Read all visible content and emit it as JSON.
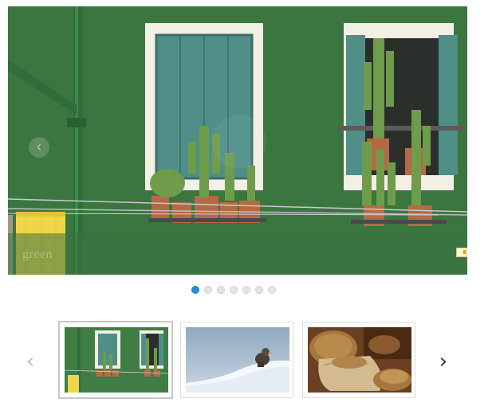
{
  "slider": {
    "caption": "green",
    "prev_glyph": "‹",
    "next_glyph": "›",
    "active_index": 0,
    "slide_count": 7
  },
  "thumbnails": {
    "prev_glyph": "‹",
    "next_glyph": "›",
    "items": [
      {
        "name": "green-wall-windows",
        "active": true
      },
      {
        "name": "bird-on-snow",
        "active": false
      },
      {
        "name": "grain-sacks",
        "active": false
      }
    ]
  },
  "colors": {
    "wall": "#3f7d45",
    "shutter": "#4f8f88",
    "dot_active": "#1e8ed8",
    "dot_inactive": "#e4e4e4"
  }
}
